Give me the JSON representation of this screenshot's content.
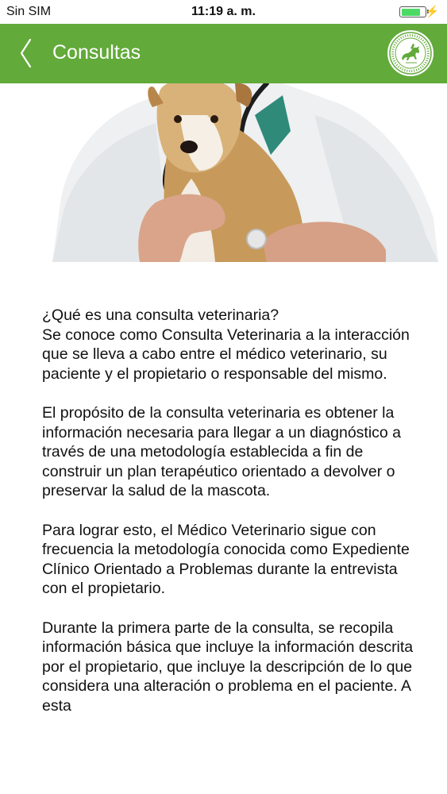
{
  "status_bar": {
    "carrier": "Sin SIM",
    "time": "11:19 a. m.",
    "battery_level": 0.85,
    "battery_color": "#4cd964"
  },
  "nav": {
    "title": "Consultas",
    "back_icon": "chevron-left-icon",
    "logo_icon": "equestrian-seal-icon",
    "bar_color": "#62aa3a"
  },
  "hero": {
    "image": "veterinarian-holding-dog"
  },
  "article": {
    "heading": "¿Qué es una consulta veterinaria?",
    "paragraphs": [
      "Se conoce como Consulta Veterinaria a la interacción que se lleva a cabo entre el médico veterinario, su paciente y el propietario o responsable del mismo.",
      "El propósito de la consulta veterinaria es obtener la información necesaria para llegar a un diagnóstico a través de una metodología establecida a fin de construir un plan terapéutico orientado a devolver o preservar la salud de la mascota.",
      "Para lograr esto, el Médico Veterinario sigue con frecuencia la metodología conocida como Expediente Clínico Orientado a Problemas durante la entrevista con el propietario.",
      "Durante la primera parte de la consulta, se recopila información básica que incluye la información descrita por el propietario, que incluye la descripción de lo que considera una alteración o problema en el paciente. A esta"
    ]
  }
}
